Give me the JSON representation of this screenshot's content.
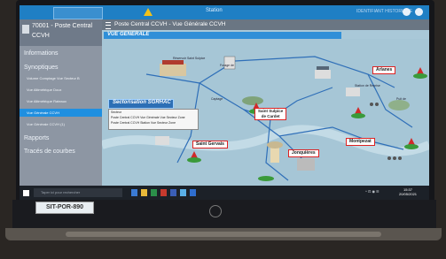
{
  "topbar": {
    "title": "Station",
    "user": "IDENTIFIANT HISTORIQUE"
  },
  "sidebar": {
    "station_line1": "70001 - Poste Central",
    "station_line2": "CCVH",
    "sections": {
      "informations": "Informations",
      "synoptiques": "Synoptiques",
      "rapports": "Rapports",
      "traces": "Tracés de courbes"
    },
    "items": [
      "Volume Comptage Vue Secteur B",
      "Vue Altimétrique Doux",
      "Vue Altimétrique Rateaux",
      "Vue Générale CCVH",
      "Vue Générale CCVH (1)"
    ]
  },
  "main": {
    "header_title": "Poste Central CCVH - Vue Générale CCVH",
    "vue_label": "VUE GENERALE",
    "sectorisation": "Sectorisation SGRHAC",
    "table_rows": [
      "Secteur",
      "Poste Central CCVH   Vue Générale   Vue Secteur   Zone",
      "Poste Central CCVH   Station Vue Secteur   Zone"
    ],
    "labels": {
      "arlanes": "Arlanes",
      "saint_sulpice_1": "Saint Sulpice",
      "saint_sulpice_2": "de Cardet",
      "saint_gervais": "Saint Gervais",
      "jonquieres": "Jonquières",
      "montpezat": "Montpezat"
    },
    "notes": {
      "reservoir": "Réservoir Saint Sulpice",
      "forage": "Forage de",
      "station": "Station de Reprise",
      "puit": "Puit de",
      "captage": "Captage"
    }
  },
  "taskbar": {
    "search_placeholder": "Taper ici pour rechercher",
    "time": "15:37",
    "date": "20/05/2021"
  },
  "hardware": {
    "sticker": "SIT-POR-890",
    "brand": "hp"
  },
  "colors": {
    "accent": "#1f7fc4",
    "active_item": "#1f8fe0",
    "sidebar": "#8d96a3",
    "label_border": "#dd2222",
    "map_bg": "#a9c8d8"
  }
}
